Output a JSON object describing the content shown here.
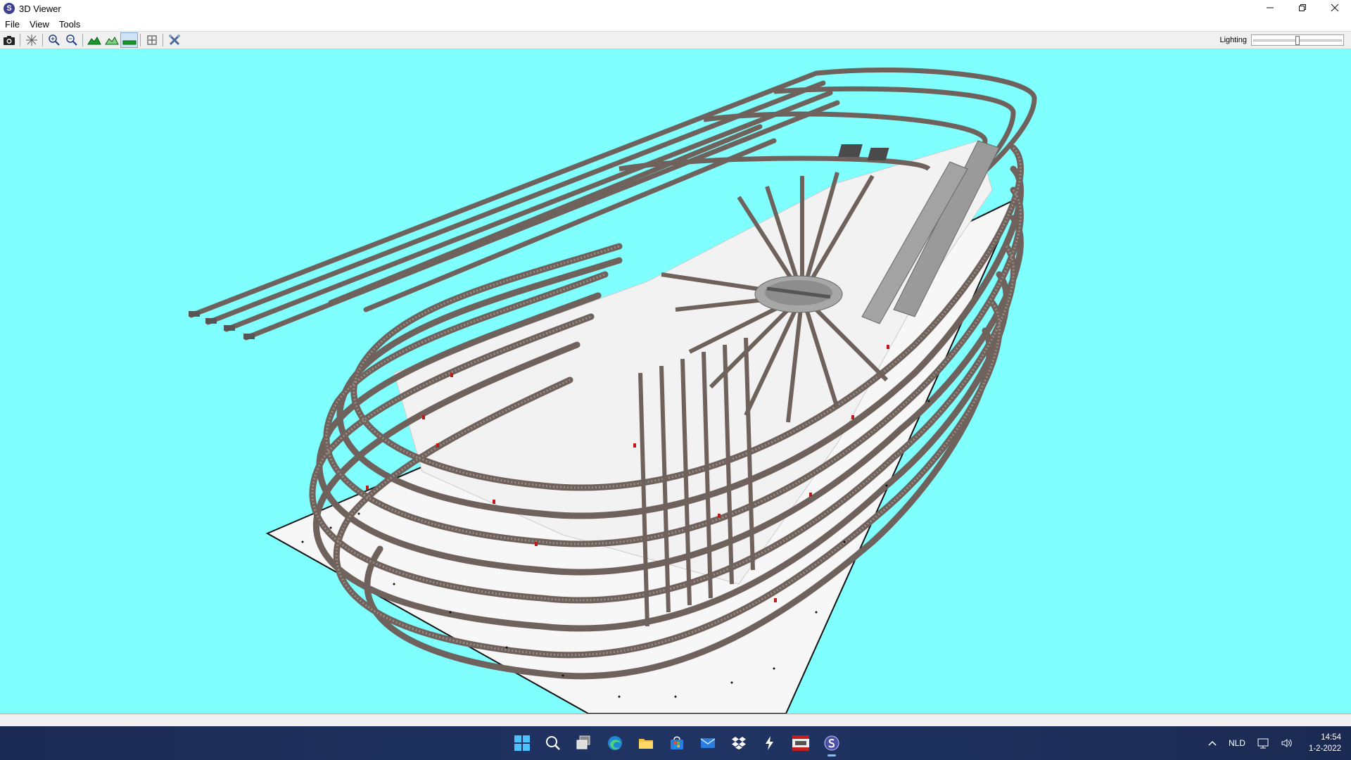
{
  "window": {
    "title": "3D Viewer",
    "app_icon_letter": "S",
    "controls": [
      "minimize",
      "restore",
      "close"
    ]
  },
  "menu": {
    "items": [
      {
        "label": "File"
      },
      {
        "label": "View"
      },
      {
        "label": "Tools"
      }
    ]
  },
  "toolbar": {
    "buttons": [
      {
        "icon": "camera-icon"
      },
      {
        "icon": "axes-icon"
      },
      {
        "icon": "zoom-in-icon"
      },
      {
        "icon": "zoom-out-icon"
      },
      {
        "icon": "terrain-icon"
      },
      {
        "icon": "terrain-outline-icon"
      },
      {
        "icon": "flat-ground-icon",
        "active": true
      },
      {
        "icon": "fit-view-icon"
      },
      {
        "icon": "tools-icon"
      }
    ],
    "lighting": {
      "label": "Lighting",
      "value_fraction": 0.5
    }
  },
  "viewport": {
    "background_color": "#80ffff",
    "content": "3D model railway track layout"
  },
  "taskbar": {
    "apps": [
      {
        "name": "start-icon"
      },
      {
        "name": "search-icon"
      },
      {
        "name": "task-view-icon"
      },
      {
        "name": "edge-icon"
      },
      {
        "name": "file-explorer-icon"
      },
      {
        "name": "store-icon"
      },
      {
        "name": "mail-icon"
      },
      {
        "name": "dropbox-icon"
      },
      {
        "name": "bolt-app-icon"
      },
      {
        "name": "wdp-app-icon"
      },
      {
        "name": "3d-viewer-app-icon",
        "active": true
      }
    ],
    "tray": {
      "language": "NLD",
      "time": "14:54",
      "date": "1-2-2022"
    }
  }
}
